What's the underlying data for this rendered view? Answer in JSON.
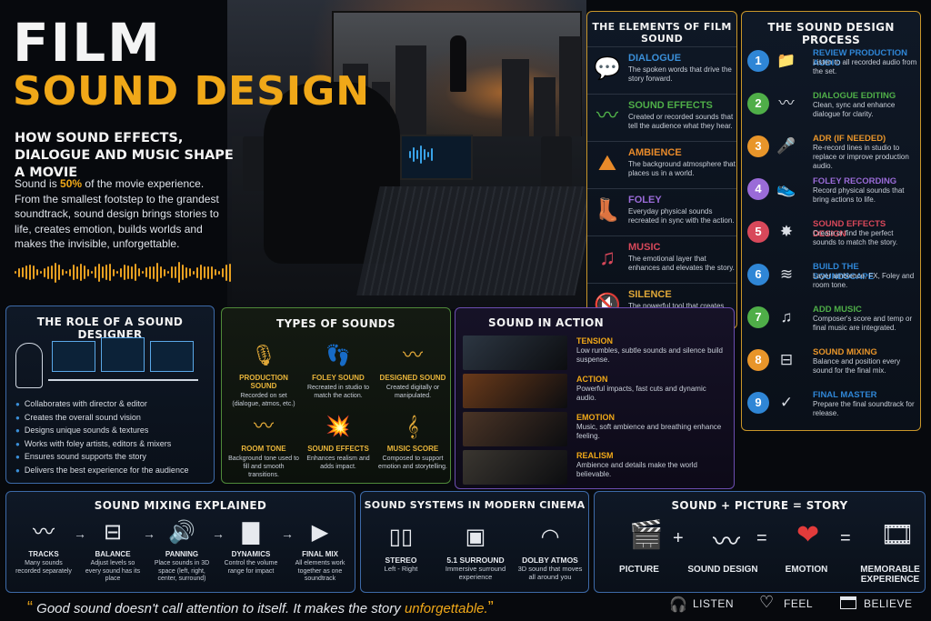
{
  "hero": {
    "title_line1": "FILM",
    "title_line2": "SOUND DESIGN",
    "subtitle": "HOW SOUND EFFECTS, DIALOGUE AND MUSIC SHAPE A MOVIE",
    "intro_pre": "Sound is ",
    "intro_highlight": "50%",
    "intro_post": " of the movie experience. From the smallest footstep to the grandest soundtrack, sound design brings stories to life, creates emotion, builds worlds and makes the invisible, unforgettable."
  },
  "elements": {
    "title": "THE ELEMENTS OF FILM SOUND",
    "items": [
      {
        "name": "DIALOGUE",
        "desc": "The spoken words that drive the story forward.",
        "color": "#3a8fd8",
        "icon": "speech-bubble-icon"
      },
      {
        "name": "SOUND EFFECTS",
        "desc": "Created or recorded sounds that tell the audience what they hear.",
        "color": "#4fae48",
        "icon": "waveform-icon"
      },
      {
        "name": "AMBIENCE",
        "desc": "The background atmosphere that places us in a world.",
        "color": "#e88a2a",
        "icon": "mountain-icon"
      },
      {
        "name": "FOLEY",
        "desc": "Everyday physical sounds recreated in sync with the action.",
        "color": "#9a6bd8",
        "icon": "boot-icon"
      },
      {
        "name": "MUSIC",
        "desc": "The emotional layer that enhances and elevates the story.",
        "color": "#d8485a",
        "icon": "music-note-icon"
      },
      {
        "name": "SILENCE",
        "desc": "The powerful tool that creates tension, focus and impact.",
        "color": "#e0a838",
        "icon": "mute-icon"
      }
    ]
  },
  "process": {
    "title": "THE SOUND DESIGN PROCESS",
    "steps": [
      {
        "num": "1",
        "name": "REVIEW PRODUCTION AUDIO",
        "desc": "Listen to all recorded audio from the set.",
        "color": "#2f86d6",
        "icon": "folder-icon"
      },
      {
        "num": "2",
        "name": "DIALOGUE EDITING",
        "desc": "Clean, sync and enhance dialogue for clarity.",
        "color": "#4fae48",
        "icon": "waveform-icon"
      },
      {
        "num": "3",
        "name": "ADR (IF NEEDED)",
        "desc": "Re-record lines in studio to replace or improve production audio.",
        "color": "#e8952a",
        "icon": "microphone-icon"
      },
      {
        "num": "4",
        "name": "FOLEY RECORDING",
        "desc": "Record physical sounds that bring actions to life.",
        "color": "#9a6bd8",
        "icon": "shoe-icon"
      },
      {
        "num": "5",
        "name": "SOUND EFFECTS DESIGN",
        "desc": "Create or find the perfect sounds to match the story.",
        "color": "#d8485a",
        "icon": "explosion-icon"
      },
      {
        "num": "6",
        "name": "BUILD THE SOUNDSCAPE",
        "desc": "Layer ambience, FX, Foley and room tone.",
        "color": "#2f86d6",
        "icon": "waves-icon"
      },
      {
        "num": "7",
        "name": "ADD MUSIC",
        "desc": "Composer's score and temp or final music are integrated.",
        "color": "#4fae48",
        "icon": "music-note-icon"
      },
      {
        "num": "8",
        "name": "SOUND MIXING",
        "desc": "Balance and position every sound for the final mix.",
        "color": "#e8952a",
        "icon": "sliders-icon"
      },
      {
        "num": "9",
        "name": "FINAL MASTER",
        "desc": "Prepare the final soundtrack for release.",
        "color": "#2f86d6",
        "icon": "checkmark-icon"
      }
    ]
  },
  "role": {
    "title": "THE ROLE OF A SOUND DESIGNER",
    "bullets": [
      "Collaborates with director & editor",
      "Creates the overall sound vision",
      "Designs unique sounds & textures",
      "Works with foley artists, editors & mixers",
      "Ensures sound supports the story",
      "Delivers the best experience for the audience"
    ]
  },
  "types": {
    "title": "TYPES OF SOUNDS",
    "items": [
      {
        "name": "PRODUCTION SOUND",
        "desc": "Recorded on set (dialogue, atmos, etc.)",
        "icon": "boom-mic-icon"
      },
      {
        "name": "FOLEY SOUND",
        "desc": "Recreated in studio to match the action.",
        "icon": "footprints-icon"
      },
      {
        "name": "DESIGNED SOUND",
        "desc": "Created digitally or manipulated.",
        "icon": "waveform-icon"
      },
      {
        "name": "ROOM TONE",
        "desc": "Background tone used to fill and smooth transitions.",
        "icon": "waveform-icon"
      },
      {
        "name": "SOUND EFFECTS",
        "desc": "Enhances realism and adds impact.",
        "icon": "explosion-car-icon"
      },
      {
        "name": "MUSIC SCORE",
        "desc": "Composed to support emotion and storytelling.",
        "icon": "sheet-music-icon"
      }
    ]
  },
  "action": {
    "title": "SOUND IN ACTION",
    "items": [
      {
        "name": "TENSION",
        "desc": "Low rumbles, subtle sounds and silence build suspense.",
        "tint": "#2c3642"
      },
      {
        "name": "ACTION",
        "desc": "Powerful impacts, fast cuts and dynamic audio.",
        "tint": "#6a3a1a"
      },
      {
        "name": "EMOTION",
        "desc": "Music, soft ambience and breathing enhance feeling.",
        "tint": "#4a3426"
      },
      {
        "name": "REALISM",
        "desc": "Ambience and details make the world believable.",
        "tint": "#3a3630"
      }
    ]
  },
  "mixing": {
    "title": "SOUND MIXING EXPLAINED",
    "items": [
      {
        "name": "TRACKS",
        "desc": "Many sounds recorded separately",
        "icon": "waveform-icon"
      },
      {
        "name": "BALANCE",
        "desc": "Adjust levels so every sound has its place",
        "icon": "sliders-icon"
      },
      {
        "name": "PANNING",
        "desc": "Place sounds in 3D space (left, right, center, surround)",
        "icon": "speaker-icon"
      },
      {
        "name": "DYNAMICS",
        "desc": "Control the volume range for impact",
        "icon": "bars-icon"
      },
      {
        "name": "FINAL MIX",
        "desc": "All elements work together as one soundtrack",
        "icon": "play-icon"
      }
    ]
  },
  "systems": {
    "title": "SOUND SYSTEMS IN MODERN CINEMA",
    "items": [
      {
        "name": "STEREO",
        "desc": "Left - Right",
        "icon": "stereo-speakers-icon"
      },
      {
        "name": "5.1 SURROUND",
        "desc": "Immersive surround experience",
        "icon": "surround-system-icon"
      },
      {
        "name": "DOLBY ATMOS",
        "desc": "3D sound that moves all around you",
        "icon": "dome-icon"
      }
    ]
  },
  "equation": {
    "title": "SOUND + PICTURE = STORY",
    "items": [
      {
        "label": "PICTURE",
        "icon": "clapperboard-icon"
      },
      {
        "label": "SOUND DESIGN",
        "icon": "waveform-icon"
      },
      {
        "label": "EMOTION",
        "icon": "heart-icon"
      },
      {
        "label": "MEMORABLE EXPERIENCE",
        "icon": "clapperboard-play-icon"
      }
    ],
    "ops": [
      "+",
      "=",
      "="
    ]
  },
  "footer": {
    "quote_pre": "Good sound doesn't call attention to itself. It makes the story ",
    "quote_highlight": "unforgettable.",
    "open_quote": "“",
    "close_quote": "”",
    "items": [
      "LISTEN",
      "FEEL",
      "BELIEVE"
    ]
  },
  "colors": {
    "accent": "#f0a818",
    "background": "#07090d"
  }
}
